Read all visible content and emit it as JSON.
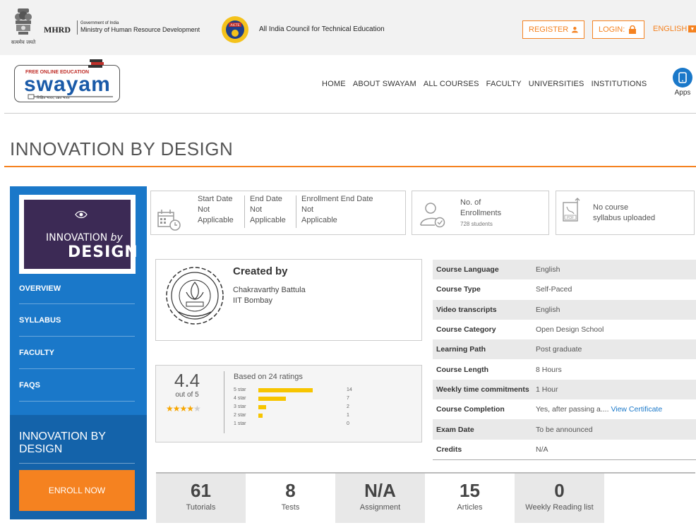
{
  "header": {
    "emblem_caption": "सत्यमेव जयते",
    "mhrd_title": "MHRD",
    "gov_of_india": "Government of India",
    "ministry": "Ministry of Human Resource Development",
    "aicte_name": "All India Council for Technical Education",
    "register_label": "REGISTER",
    "login_label": "LOGIN:",
    "language": "ENGLISH",
    "accent_color": "#f58220"
  },
  "logo": {
    "tag": "FREE ONLINE EDUCATION",
    "name": "swayam",
    "tagline": "शिक्षित भारत, उन्नत भारत"
  },
  "nav": {
    "items": [
      "HOME",
      "ABOUT SWAYAM",
      "ALL COURSES",
      "FACULTY",
      "UNIVERSITIES",
      "INSTITUTIONS"
    ],
    "apps_label": "Apps"
  },
  "course": {
    "title": "INNOVATION BY DESIGN",
    "thumb_line1": "INNOVATION",
    "thumb_line1b": "by",
    "thumb_line2": "DESIGN"
  },
  "sidebar": {
    "items": [
      "OVERVIEW",
      "SYLLABUS",
      "FACULTY",
      "FAQS"
    ],
    "course_name": "INNOVATION BY DESIGN",
    "enroll_label": "ENROLL NOW",
    "color": "#1a78c9"
  },
  "dates": {
    "start_label": "Start Date",
    "start_value_1": "Not",
    "start_value_2": "Applicable",
    "end_label": "End Date",
    "end_value_1": "Not",
    "end_value_2": "Applicable",
    "enroll_end_label": "Enrollment End Date",
    "enroll_end_value_1": "Not",
    "enroll_end_value_2": "Applicable"
  },
  "enrollments": {
    "label_1": "No. of",
    "label_2": "Enrollments",
    "count": "728 students"
  },
  "syllabus": {
    "line1": "No course",
    "line2": "syllabus uploaded"
  },
  "creator": {
    "heading": "Created by",
    "name": "Chakravarthy Battula",
    "institute": "IIT Bombay"
  },
  "rating": {
    "average": "4.4",
    "out_of": "out of 5",
    "based_on": "Based on 24 ratings",
    "stars_filled": 4.4,
    "breakdown": [
      {
        "label": "5 star",
        "count": "14",
        "value": 14
      },
      {
        "label": "4 star",
        "count": "7",
        "value": 7
      },
      {
        "label": "3 star",
        "count": "2",
        "value": 2
      },
      {
        "label": "2 star",
        "count": "1",
        "value": 1
      },
      {
        "label": "1 star",
        "count": "0",
        "value": 0
      }
    ]
  },
  "details": [
    {
      "key": "Course Language",
      "value": "English"
    },
    {
      "key": "Course Type",
      "value": "Self-Paced"
    },
    {
      "key": "Video transcripts",
      "value": "English"
    },
    {
      "key": "Course Category",
      "value": "Open Design School"
    },
    {
      "key": "Learning Path",
      "value": "Post graduate"
    },
    {
      "key": "Course Length",
      "value": "8 Hours"
    },
    {
      "key": "Weekly time commitments",
      "value": "1 Hour"
    },
    {
      "key": "Course Completion",
      "value": "Yes, after passing a....",
      "link": "View Certificate"
    },
    {
      "key": "Exam Date",
      "value": "To be announced"
    },
    {
      "key": "Credits",
      "value": "N/A"
    }
  ],
  "stats": [
    {
      "num": "61",
      "label": "Tutorials"
    },
    {
      "num": "8",
      "label": "Tests"
    },
    {
      "num": "N/A",
      "label": "Assignment"
    },
    {
      "num": "15",
      "label": "Articles"
    },
    {
      "num": "0",
      "label": "Weekly Reading list"
    }
  ]
}
